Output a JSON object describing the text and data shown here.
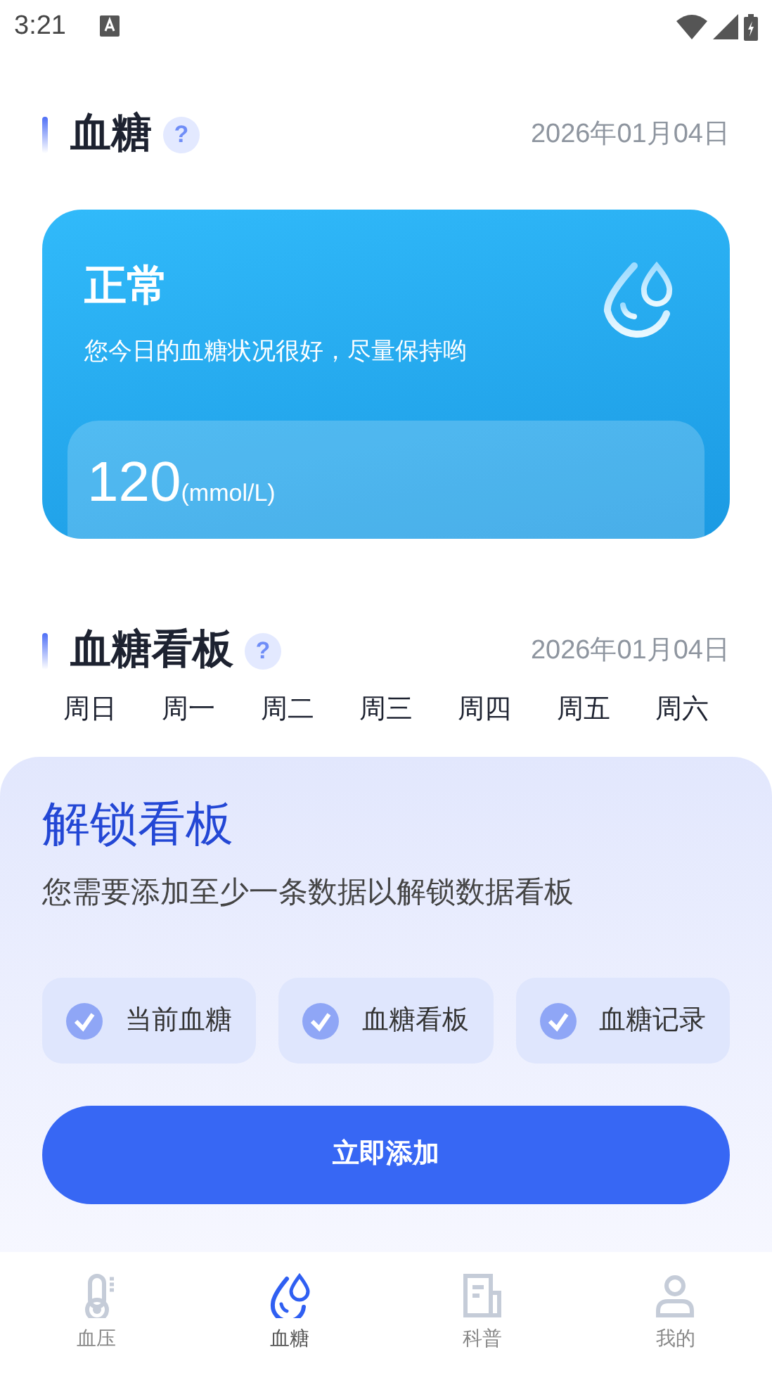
{
  "status_bar": {
    "time": "3:21"
  },
  "section": {
    "title": "血糖",
    "date": "2026年01月04日",
    "help": "?"
  },
  "status_card": {
    "status": "正常",
    "message": "您今日的血糖状况很好，尽量保持哟",
    "value": "120",
    "unit": "(mmol/L)"
  },
  "board": {
    "title": "血糖看板",
    "date": "2026年01月04日",
    "help": "?",
    "weekdays": [
      "周日",
      "周一",
      "周二",
      "周三",
      "周四",
      "周五",
      "周六"
    ]
  },
  "unlock_sheet": {
    "title": "解锁看板",
    "message": "您需要添加至少一条数据以解锁数据看板",
    "features": [
      {
        "label": "当前血糖",
        "checked": true
      },
      {
        "label": "血糖看板",
        "checked": true
      },
      {
        "label": "血糖记录",
        "checked": true
      }
    ],
    "button": "立即添加"
  },
  "tab_bar": [
    {
      "label": "血压",
      "kind": "thermometer",
      "selected": false
    },
    {
      "label": "血糖",
      "kind": "drops",
      "selected": true
    },
    {
      "label": "科普",
      "kind": "article",
      "selected": false
    },
    {
      "label": "我的",
      "kind": "person",
      "selected": false
    }
  ]
}
